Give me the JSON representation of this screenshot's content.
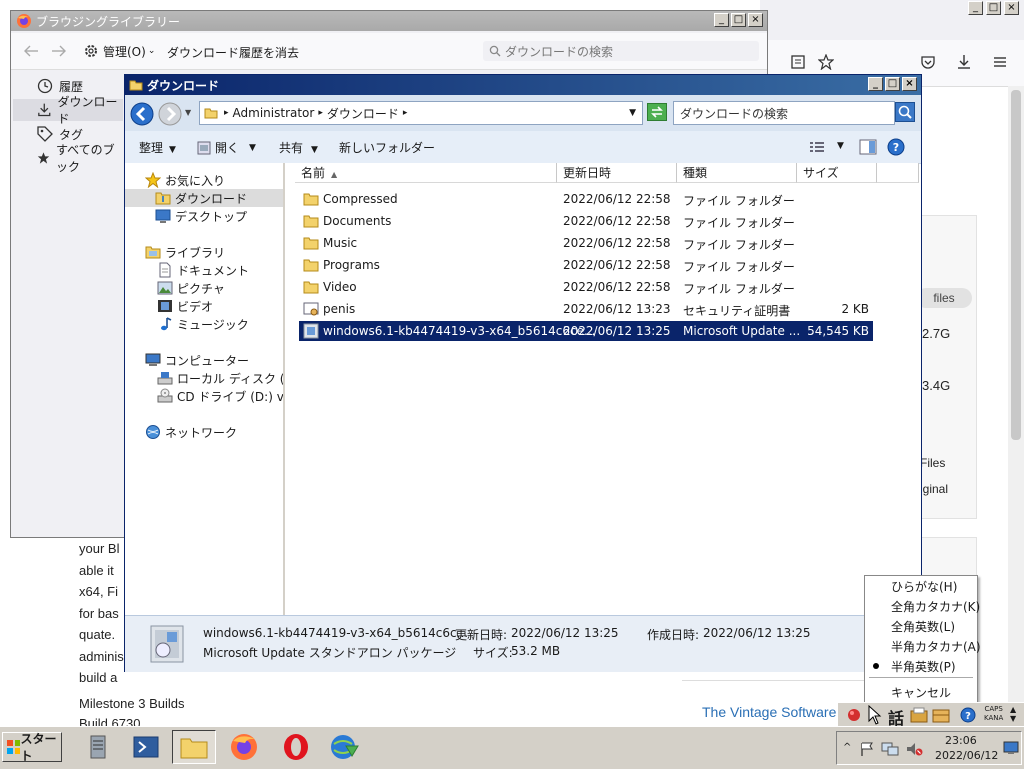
{
  "background_browser": {
    "window_buttons": [
      "_",
      "□",
      "×"
    ],
    "sidebar_card": {
      "pill": "files",
      "size1": "2.7G",
      "size2": "3.4G",
      "item1": "Files",
      "item2": "iginal"
    },
    "body_lines": [
      "your Bl",
      "able it",
      "x64, Fi",
      "for bas",
      "quate.",
      "adminis",
      "build a"
    ],
    "milestone_heading": "Milestone 3 Builds",
    "milestone_sub": "Build 6730",
    "link_text": "The Vintage Software"
  },
  "library": {
    "title": "ブラウジングライブラリー",
    "toolbar": {
      "manage": "管理(O)",
      "clear": "ダウンロード履歴を消去",
      "search_placeholder": "ダウンロードの検索"
    },
    "sidebar": [
      {
        "icon": "clock-icon",
        "label": "履歴"
      },
      {
        "icon": "download-icon",
        "label": "ダウンロード"
      },
      {
        "icon": "tag-icon",
        "label": "タグ"
      },
      {
        "icon": "star-icon",
        "label": "すべてのブック"
      }
    ]
  },
  "explorer": {
    "title": "ダウンロード",
    "breadcrumb": [
      "Administrator",
      "ダウンロード"
    ],
    "search_placeholder": "ダウンロードの検索",
    "commands": {
      "organize": "整理",
      "open": "開く",
      "share": "共有",
      "new_folder": "新しいフォルダー"
    },
    "nav": {
      "favorites": "お気に入り",
      "downloads": "ダウンロード",
      "desktop": "デスクトップ",
      "libraries": "ライブラリ",
      "documents": "ドキュメント",
      "pictures": "ピクチャ",
      "videos": "ビデオ",
      "music": "ミュージック",
      "computer": "コンピューター",
      "local_disk": "ローカル ディスク (C:)",
      "cd_drive": "CD ドライブ (D:) virtio",
      "network": "ネットワーク"
    },
    "columns": {
      "name": "名前",
      "date": "更新日時",
      "type": "種類",
      "size": "サイズ"
    },
    "files": [
      {
        "name": "Compressed",
        "date": "2022/06/12 22:58",
        "type": "ファイル フォルダー",
        "size": "",
        "kind": "folder"
      },
      {
        "name": "Documents",
        "date": "2022/06/12 22:58",
        "type": "ファイル フォルダー",
        "size": "",
        "kind": "folder"
      },
      {
        "name": "Music",
        "date": "2022/06/12 22:58",
        "type": "ファイル フォルダー",
        "size": "",
        "kind": "folder"
      },
      {
        "name": "Programs",
        "date": "2022/06/12 22:58",
        "type": "ファイル フォルダー",
        "size": "",
        "kind": "folder"
      },
      {
        "name": "Video",
        "date": "2022/06/12 22:58",
        "type": "ファイル フォルダー",
        "size": "",
        "kind": "folder"
      },
      {
        "name": "penis",
        "date": "2022/06/12 13:23",
        "type": "セキュリティ証明書",
        "size": "2 KB",
        "kind": "cert"
      },
      {
        "name": "windows6.1-kb4474419-v3-x64_b5614c6ce...",
        "date": "2022/06/12 13:25",
        "type": "Microsoft Update ...",
        "size": "54,545 KB",
        "kind": "msu"
      }
    ],
    "details": {
      "filename": "windows6.1-kb4474419-v3-x64_b5614c6c...",
      "modified_label": "更新日時:",
      "modified": "2022/06/12 13:25",
      "created_label": "作成日時:",
      "created": "2022/06/12 13:25",
      "type": "Microsoft Update スタンドアロン パッケージ",
      "size_label": "サイズ:",
      "size": "53.2 MB"
    }
  },
  "ime_menu": {
    "items": [
      "ひらがな(H)",
      "全角カタカナ(K)",
      "全角英数(L)",
      "半角カタカナ(A)",
      "半角英数(P)",
      "キャンセル"
    ],
    "checked": "半角英数(P)"
  },
  "language_bar": {
    "talk": "話",
    "caps": "CAPS",
    "kana": "KANA"
  },
  "taskbar": {
    "start": "スタート",
    "time": "23:06",
    "date": "2022/06/12"
  },
  "colors": {
    "selection": "#0a246a",
    "title_active": "#0a246a",
    "taskbar": "#d4d0c8"
  }
}
